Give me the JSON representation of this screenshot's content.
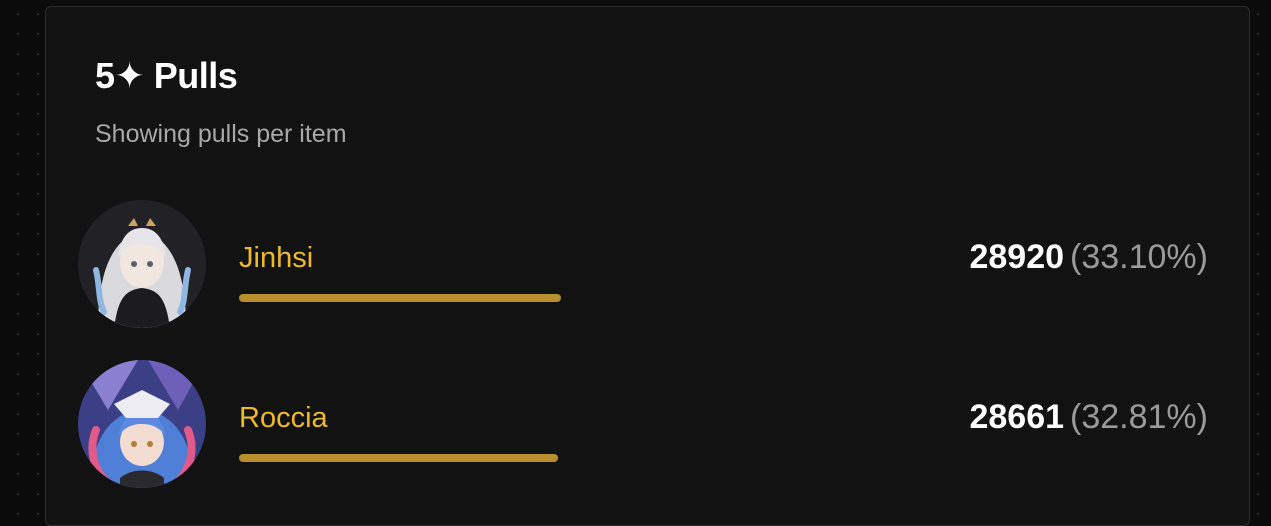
{
  "card": {
    "title": "5✦ Pulls",
    "subtitle": "Showing pulls per item"
  },
  "items": [
    {
      "name": "Jinhsi",
      "count": "28920",
      "percent": "(33.10%)",
      "bar_fraction": 0.537,
      "avatar_icon": "jinhsi-portrait"
    },
    {
      "name": "Roccia",
      "count": "28661",
      "percent": "(32.81%)",
      "bar_fraction": 0.532,
      "avatar_icon": "roccia-portrait"
    }
  ],
  "colors": {
    "name": "#f0b92c",
    "bar": "#b7902c",
    "card_bg": "#121212",
    "page_bg": "#0b0b0b"
  }
}
